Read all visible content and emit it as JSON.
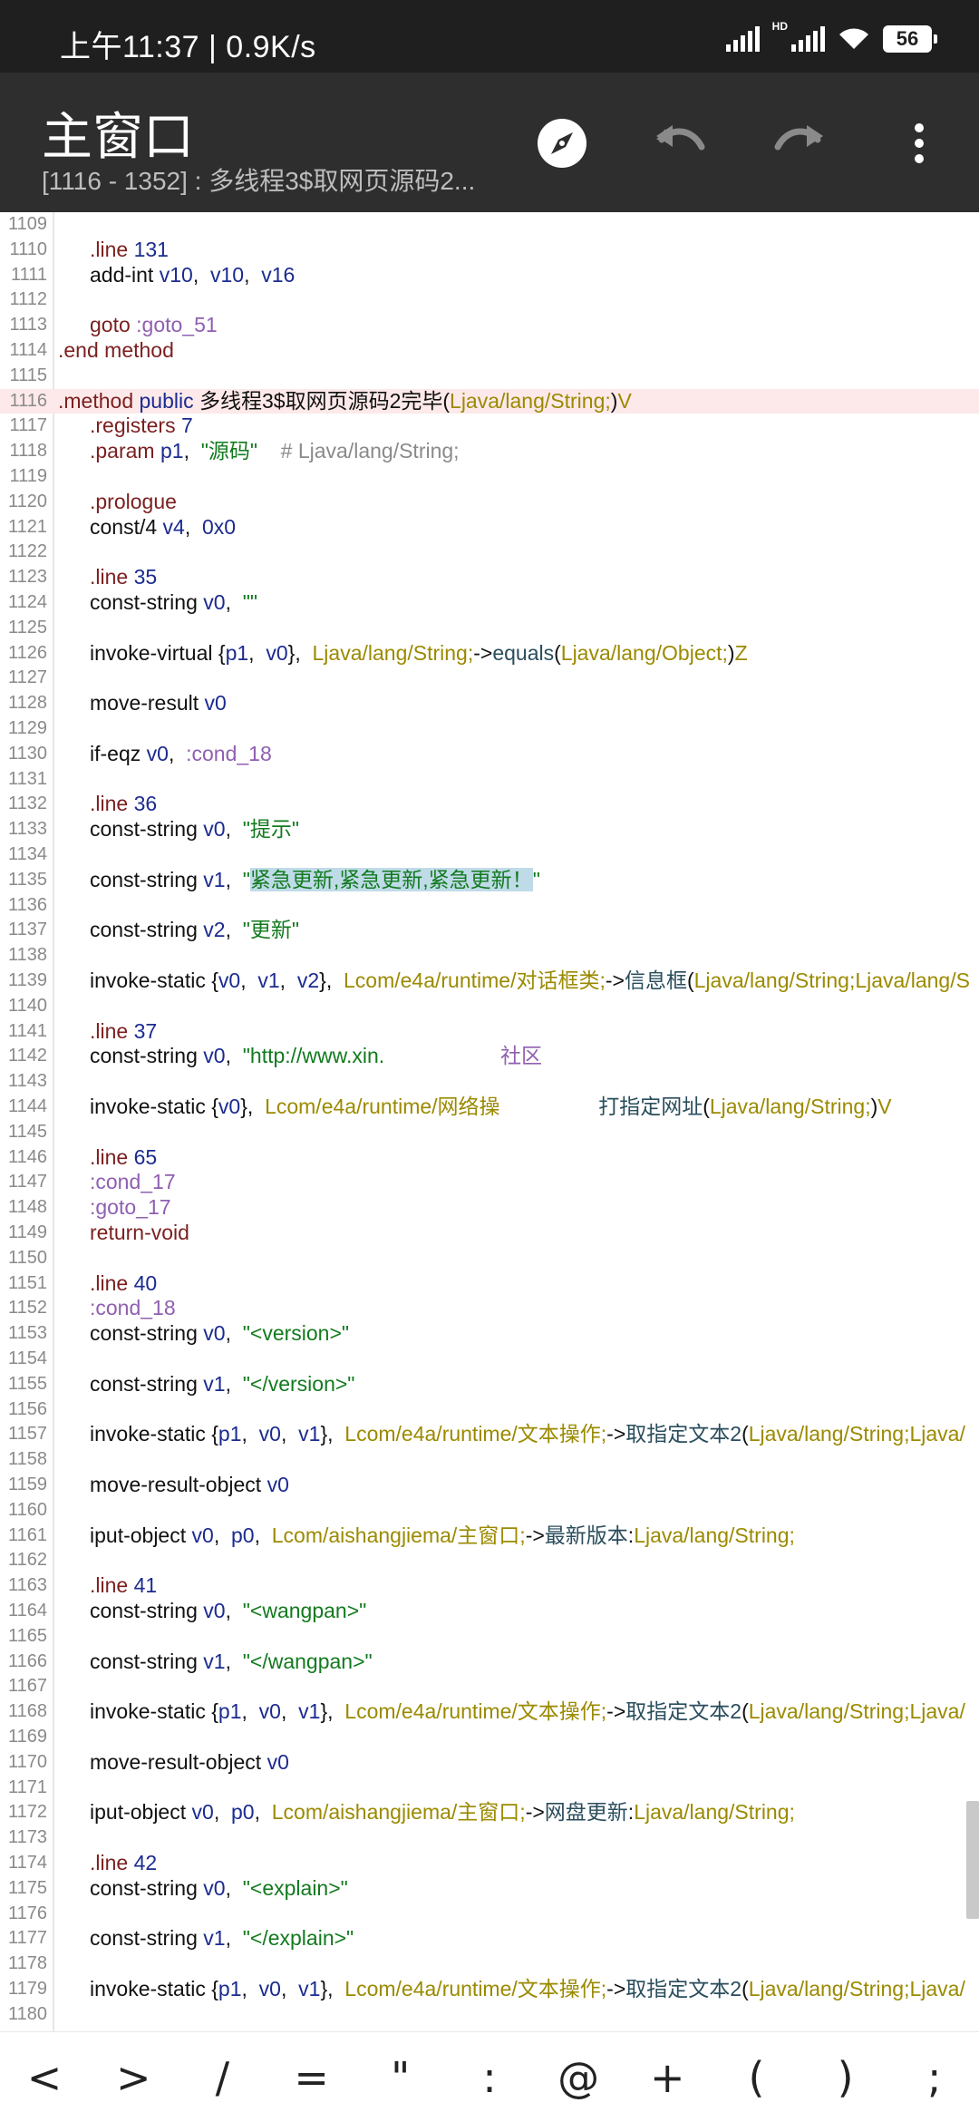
{
  "status_bar": {
    "time_text": "上午11:37 | 0.9K/s",
    "hd_label": "HD",
    "battery": "56"
  },
  "app_bar": {
    "title": "主窗口",
    "subtitle": "[1116 - 1352] : 多线程3$取网页源码2...",
    "icons": [
      "compass-icon",
      "undo-icon",
      "redo-icon",
      "more-vert-icon"
    ]
  },
  "code": {
    "first_line": 1109,
    "highlight_line": 1116,
    "lines": [
      {
        "n": "1109",
        "seg": []
      },
      {
        "n": "1110",
        "i": 1,
        "seg": [
          [
            ".line ",
            "c-kw"
          ],
          [
            "131",
            "c-num"
          ]
        ]
      },
      {
        "n": "1111",
        "i": 1,
        "seg": [
          [
            "add-int ",
            "c-op"
          ],
          [
            "v10",
            "c-reg"
          ],
          [
            ",  ",
            "c-op"
          ],
          [
            "v10",
            "c-reg"
          ],
          [
            ",  ",
            "c-op"
          ],
          [
            "v16",
            "c-reg"
          ]
        ]
      },
      {
        "n": "1112",
        "seg": []
      },
      {
        "n": "1113",
        "i": 1,
        "seg": [
          [
            "goto ",
            "c-kw"
          ],
          [
            ":goto_51",
            "c-label"
          ]
        ]
      },
      {
        "n": "1114",
        "i": 0,
        "seg": [
          [
            ".end ",
            "c-kw"
          ],
          [
            "method",
            "c-kw"
          ]
        ]
      },
      {
        "n": "1115",
        "seg": []
      },
      {
        "n": "1116",
        "i": 0,
        "seg": [
          [
            ".method ",
            "c-kw"
          ],
          [
            "public ",
            "c-reg"
          ],
          [
            "多线程3$取网页源码2完毕",
            "c-op"
          ],
          [
            "(",
            "c-op"
          ],
          [
            "Ljava/lang/String;",
            "c-type"
          ],
          [
            ")",
            "c-op"
          ],
          [
            "V",
            "c-type"
          ]
        ]
      },
      {
        "n": "1117",
        "i": 1,
        "seg": [
          [
            ".registers ",
            "c-kw"
          ],
          [
            "7",
            "c-num"
          ]
        ]
      },
      {
        "n": "1118",
        "i": 1,
        "seg": [
          [
            ".param ",
            "c-kw"
          ],
          [
            "p1",
            "c-reg"
          ],
          [
            ",  ",
            "c-op"
          ],
          [
            "\"源码\"",
            "c-str"
          ],
          [
            "    # Ljava/lang/String;",
            "c-cmt"
          ]
        ]
      },
      {
        "n": "1119",
        "seg": []
      },
      {
        "n": "1120",
        "i": 1,
        "seg": [
          [
            ".prologue",
            "c-kw"
          ]
        ]
      },
      {
        "n": "1121",
        "i": 1,
        "seg": [
          [
            "const/4 ",
            "c-op"
          ],
          [
            "v4",
            "c-reg"
          ],
          [
            ",  ",
            "c-op"
          ],
          [
            "0x0",
            "c-num"
          ]
        ]
      },
      {
        "n": "1122",
        "seg": []
      },
      {
        "n": "1123",
        "i": 1,
        "seg": [
          [
            ".line ",
            "c-kw"
          ],
          [
            "35",
            "c-num"
          ]
        ]
      },
      {
        "n": "1124",
        "i": 1,
        "seg": [
          [
            "const-string ",
            "c-op"
          ],
          [
            "v0",
            "c-reg"
          ],
          [
            ",  ",
            "c-op"
          ],
          [
            "\"\"",
            "c-str"
          ]
        ]
      },
      {
        "n": "1125",
        "seg": []
      },
      {
        "n": "1126",
        "i": 1,
        "seg": [
          [
            "invoke-virtual ",
            "c-op"
          ],
          [
            "{",
            "c-op"
          ],
          [
            "p1",
            "c-reg"
          ],
          [
            ",  ",
            "c-op"
          ],
          [
            "v0",
            "c-reg"
          ],
          [
            "},  ",
            "c-op"
          ],
          [
            "Ljava/lang/String;",
            "c-type"
          ],
          [
            "->",
            "c-op"
          ],
          [
            "equals",
            "c-meth"
          ],
          [
            "(",
            "c-op"
          ],
          [
            "Ljava/lang/Object;",
            "c-type"
          ],
          [
            ")",
            "c-op"
          ],
          [
            "Z",
            "c-type"
          ]
        ]
      },
      {
        "n": "1127",
        "seg": []
      },
      {
        "n": "1128",
        "i": 1,
        "seg": [
          [
            "move-result ",
            "c-op"
          ],
          [
            "v0",
            "c-reg"
          ]
        ]
      },
      {
        "n": "1129",
        "seg": []
      },
      {
        "n": "1130",
        "i": 1,
        "seg": [
          [
            "if-eqz ",
            "c-op"
          ],
          [
            "v0",
            "c-reg"
          ],
          [
            ",  ",
            "c-op"
          ],
          [
            ":cond_18",
            "c-label"
          ]
        ]
      },
      {
        "n": "1131",
        "seg": []
      },
      {
        "n": "1132",
        "i": 1,
        "seg": [
          [
            ".line ",
            "c-kw"
          ],
          [
            "36",
            "c-num"
          ]
        ]
      },
      {
        "n": "1133",
        "i": 1,
        "seg": [
          [
            "const-string ",
            "c-op"
          ],
          [
            "v0",
            "c-reg"
          ],
          [
            ",  ",
            "c-op"
          ],
          [
            "\"提示\"",
            "c-str"
          ]
        ]
      },
      {
        "n": "1134",
        "seg": []
      },
      {
        "n": "1135",
        "i": 1,
        "seg": [
          [
            "const-string ",
            "c-op"
          ],
          [
            "v1",
            "c-reg"
          ],
          [
            ",  ",
            "c-op"
          ],
          [
            "\"",
            "c-str"
          ],
          [
            "紧急更新,紧急更新,紧急更新！",
            "c-str sel"
          ],
          [
            "\"",
            "c-str"
          ]
        ]
      },
      {
        "n": "1136",
        "seg": []
      },
      {
        "n": "1137",
        "i": 1,
        "seg": [
          [
            "const-string ",
            "c-op"
          ],
          [
            "v2",
            "c-reg"
          ],
          [
            ",  ",
            "c-op"
          ],
          [
            "\"更新\"",
            "c-str"
          ]
        ]
      },
      {
        "n": "1138",
        "seg": []
      },
      {
        "n": "1139",
        "i": 1,
        "seg": [
          [
            "invoke-static ",
            "c-op"
          ],
          [
            "{",
            "c-op"
          ],
          [
            "v0",
            "c-reg"
          ],
          [
            ",  ",
            "c-op"
          ],
          [
            "v1",
            "c-reg"
          ],
          [
            ",  ",
            "c-op"
          ],
          [
            "v2",
            "c-reg"
          ],
          [
            "},  ",
            "c-op"
          ],
          [
            "Lcom/e4a/runtime/对话框类;",
            "c-type"
          ],
          [
            "->",
            "c-op"
          ],
          [
            "信息框",
            "c-meth"
          ],
          [
            "(",
            "c-op"
          ],
          [
            "Ljava/lang/String;Ljava/lang/S",
            "c-type"
          ]
        ]
      },
      {
        "n": "1140",
        "seg": []
      },
      {
        "n": "1141",
        "i": 1,
        "seg": [
          [
            ".line ",
            "c-kw"
          ],
          [
            "37",
            "c-num"
          ]
        ]
      },
      {
        "n": "1142",
        "i": 1,
        "seg": [
          [
            "const-string ",
            "c-op"
          ],
          [
            "v0",
            "c-reg"
          ],
          [
            ",  ",
            "c-op"
          ],
          [
            "\"http://www.xin.",
            "c-str"
          ],
          [
            "                    社区",
            "c-label"
          ]
        ]
      },
      {
        "n": "1143",
        "seg": []
      },
      {
        "n": "1144",
        "i": 1,
        "seg": [
          [
            "invoke-static ",
            "c-op"
          ],
          [
            "{",
            "c-op"
          ],
          [
            "v0",
            "c-reg"
          ],
          [
            "},  ",
            "c-op"
          ],
          [
            "Lcom/e4a/runtime/网络操",
            "c-type"
          ],
          [
            "                 ",
            "c-op"
          ],
          [
            "打指定网址",
            "c-meth"
          ],
          [
            "(",
            "c-op"
          ],
          [
            "Ljava/lang/String;",
            "c-type"
          ],
          [
            ")",
            "c-op"
          ],
          [
            "V",
            "c-type"
          ]
        ]
      },
      {
        "n": "1145",
        "seg": []
      },
      {
        "n": "1146",
        "i": 1,
        "seg": [
          [
            ".line ",
            "c-kw"
          ],
          [
            "65",
            "c-num"
          ]
        ]
      },
      {
        "n": "1147",
        "i": 1,
        "seg": [
          [
            ":cond_17",
            "c-label"
          ]
        ]
      },
      {
        "n": "1148",
        "i": 1,
        "seg": [
          [
            ":goto_17",
            "c-label"
          ]
        ]
      },
      {
        "n": "1149",
        "i": 1,
        "seg": [
          [
            "return-void",
            "c-kw"
          ]
        ]
      },
      {
        "n": "1150",
        "seg": []
      },
      {
        "n": "1151",
        "i": 1,
        "seg": [
          [
            ".line ",
            "c-kw"
          ],
          [
            "40",
            "c-num"
          ]
        ]
      },
      {
        "n": "1152",
        "i": 1,
        "seg": [
          [
            ":cond_18",
            "c-label"
          ]
        ]
      },
      {
        "n": "1153",
        "i": 1,
        "seg": [
          [
            "const-string ",
            "c-op"
          ],
          [
            "v0",
            "c-reg"
          ],
          [
            ",  ",
            "c-op"
          ],
          [
            "\"<version>\"",
            "c-str"
          ]
        ]
      },
      {
        "n": "1154",
        "seg": []
      },
      {
        "n": "1155",
        "i": 1,
        "seg": [
          [
            "const-string ",
            "c-op"
          ],
          [
            "v1",
            "c-reg"
          ],
          [
            ",  ",
            "c-op"
          ],
          [
            "\"</version>\"",
            "c-str"
          ]
        ]
      },
      {
        "n": "1156",
        "seg": []
      },
      {
        "n": "1157",
        "i": 1,
        "seg": [
          [
            "invoke-static ",
            "c-op"
          ],
          [
            "{",
            "c-op"
          ],
          [
            "p1",
            "c-reg"
          ],
          [
            ",  ",
            "c-op"
          ],
          [
            "v0",
            "c-reg"
          ],
          [
            ",  ",
            "c-op"
          ],
          [
            "v1",
            "c-reg"
          ],
          [
            "},  ",
            "c-op"
          ],
          [
            "Lcom/e4a/runtime/文本操作;",
            "c-type"
          ],
          [
            "->",
            "c-op"
          ],
          [
            "取指定文本2",
            "c-meth"
          ],
          [
            "(",
            "c-op"
          ],
          [
            "Ljava/lang/String;Ljava/",
            "c-type"
          ]
        ]
      },
      {
        "n": "1158",
        "seg": []
      },
      {
        "n": "1159",
        "i": 1,
        "seg": [
          [
            "move-result-object ",
            "c-op"
          ],
          [
            "v0",
            "c-reg"
          ]
        ]
      },
      {
        "n": "1160",
        "seg": []
      },
      {
        "n": "1161",
        "i": 1,
        "seg": [
          [
            "iput-object ",
            "c-op"
          ],
          [
            "v0",
            "c-reg"
          ],
          [
            ",  ",
            "c-op"
          ],
          [
            "p0",
            "c-reg"
          ],
          [
            ",  ",
            "c-op"
          ],
          [
            "Lcom/aishangjiema/主窗口;",
            "c-type"
          ],
          [
            "->",
            "c-op"
          ],
          [
            "最新版本",
            "c-meth"
          ],
          [
            ":",
            "c-op"
          ],
          [
            "Ljava/lang/String;",
            "c-type"
          ]
        ]
      },
      {
        "n": "1162",
        "seg": []
      },
      {
        "n": "1163",
        "i": 1,
        "seg": [
          [
            ".line ",
            "c-kw"
          ],
          [
            "41",
            "c-num"
          ]
        ]
      },
      {
        "n": "1164",
        "i": 1,
        "seg": [
          [
            "const-string ",
            "c-op"
          ],
          [
            "v0",
            "c-reg"
          ],
          [
            ",  ",
            "c-op"
          ],
          [
            "\"<wangpan>\"",
            "c-str"
          ]
        ]
      },
      {
        "n": "1165",
        "seg": []
      },
      {
        "n": "1166",
        "i": 1,
        "seg": [
          [
            "const-string ",
            "c-op"
          ],
          [
            "v1",
            "c-reg"
          ],
          [
            ",  ",
            "c-op"
          ],
          [
            "\"</wangpan>\"",
            "c-str"
          ]
        ]
      },
      {
        "n": "1167",
        "seg": []
      },
      {
        "n": "1168",
        "i": 1,
        "seg": [
          [
            "invoke-static ",
            "c-op"
          ],
          [
            "{",
            "c-op"
          ],
          [
            "p1",
            "c-reg"
          ],
          [
            ",  ",
            "c-op"
          ],
          [
            "v0",
            "c-reg"
          ],
          [
            ",  ",
            "c-op"
          ],
          [
            "v1",
            "c-reg"
          ],
          [
            "},  ",
            "c-op"
          ],
          [
            "Lcom/e4a/runtime/文本操作;",
            "c-type"
          ],
          [
            "->",
            "c-op"
          ],
          [
            "取指定文本2",
            "c-meth"
          ],
          [
            "(",
            "c-op"
          ],
          [
            "Ljava/lang/String;Ljava/",
            "c-type"
          ]
        ]
      },
      {
        "n": "1169",
        "seg": []
      },
      {
        "n": "1170",
        "i": 1,
        "seg": [
          [
            "move-result-object ",
            "c-op"
          ],
          [
            "v0",
            "c-reg"
          ]
        ]
      },
      {
        "n": "1171",
        "seg": []
      },
      {
        "n": "1172",
        "i": 1,
        "seg": [
          [
            "iput-object ",
            "c-op"
          ],
          [
            "v0",
            "c-reg"
          ],
          [
            ",  ",
            "c-op"
          ],
          [
            "p0",
            "c-reg"
          ],
          [
            ",  ",
            "c-op"
          ],
          [
            "Lcom/aishangjiema/主窗口;",
            "c-type"
          ],
          [
            "->",
            "c-op"
          ],
          [
            "网盘更新",
            "c-meth"
          ],
          [
            ":",
            "c-op"
          ],
          [
            "Ljava/lang/String;",
            "c-type"
          ]
        ]
      },
      {
        "n": "1173",
        "seg": []
      },
      {
        "n": "1174",
        "i": 1,
        "seg": [
          [
            ".line ",
            "c-kw"
          ],
          [
            "42",
            "c-num"
          ]
        ]
      },
      {
        "n": "1175",
        "i": 1,
        "seg": [
          [
            "const-string ",
            "c-op"
          ],
          [
            "v0",
            "c-reg"
          ],
          [
            ",  ",
            "c-op"
          ],
          [
            "\"<explain>\"",
            "c-str"
          ]
        ]
      },
      {
        "n": "1176",
        "seg": []
      },
      {
        "n": "1177",
        "i": 1,
        "seg": [
          [
            "const-string ",
            "c-op"
          ],
          [
            "v1",
            "c-reg"
          ],
          [
            ",  ",
            "c-op"
          ],
          [
            "\"</explain>\"",
            "c-str"
          ]
        ]
      },
      {
        "n": "1178",
        "seg": []
      },
      {
        "n": "1179",
        "i": 1,
        "seg": [
          [
            "invoke-static ",
            "c-op"
          ],
          [
            "{",
            "c-op"
          ],
          [
            "p1",
            "c-reg"
          ],
          [
            ",  ",
            "c-op"
          ],
          [
            "v0",
            "c-reg"
          ],
          [
            ",  ",
            "c-op"
          ],
          [
            "v1",
            "c-reg"
          ],
          [
            "},  ",
            "c-op"
          ],
          [
            "Lcom/e4a/runtime/文本操作;",
            "c-type"
          ],
          [
            "->",
            "c-op"
          ],
          [
            "取指定文本2",
            "c-meth"
          ],
          [
            "(",
            "c-op"
          ],
          [
            "Ljava/lang/String;Ljava/",
            "c-type"
          ]
        ]
      },
      {
        "n": "1180",
        "seg": []
      }
    ]
  },
  "symbol_bar": {
    "keys": [
      "<",
      ">",
      "/",
      "=",
      "\"",
      ":",
      "@",
      "+",
      "(",
      ")",
      ";"
    ]
  }
}
